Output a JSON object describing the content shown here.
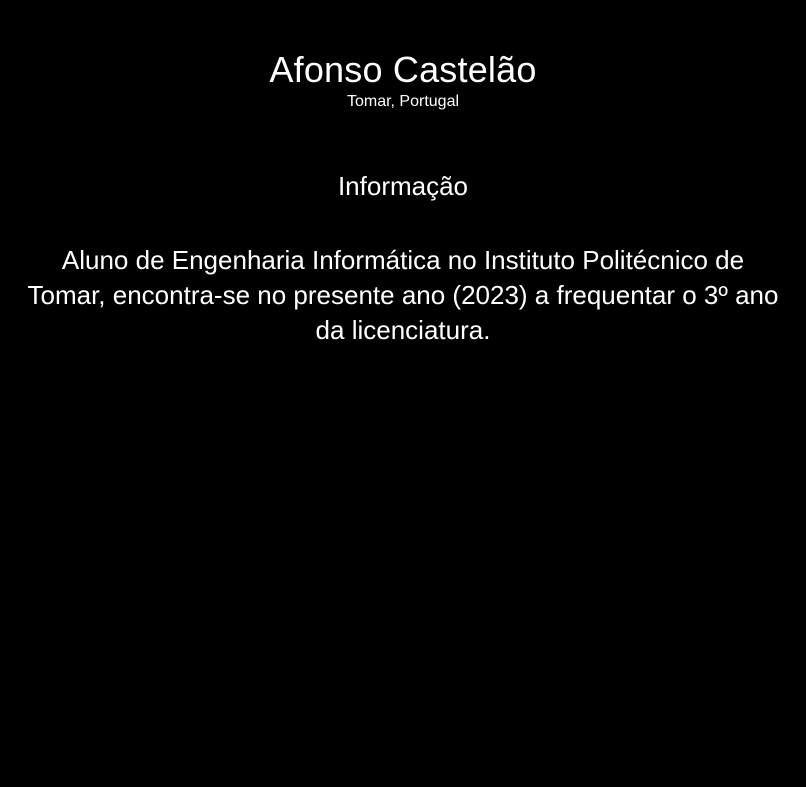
{
  "colors": {
    "background": "#000000",
    "text": "#ffffff"
  },
  "profile": {
    "name": "Afonso Castelão",
    "location": "Tomar, Portugal"
  },
  "info": {
    "title": "Informação",
    "text": "Aluno de Engenharia Informática no Instituto Politécnico de Tomar, encontra-se no presente ano (2023) a frequentar o 3º ano da licenciatura."
  }
}
